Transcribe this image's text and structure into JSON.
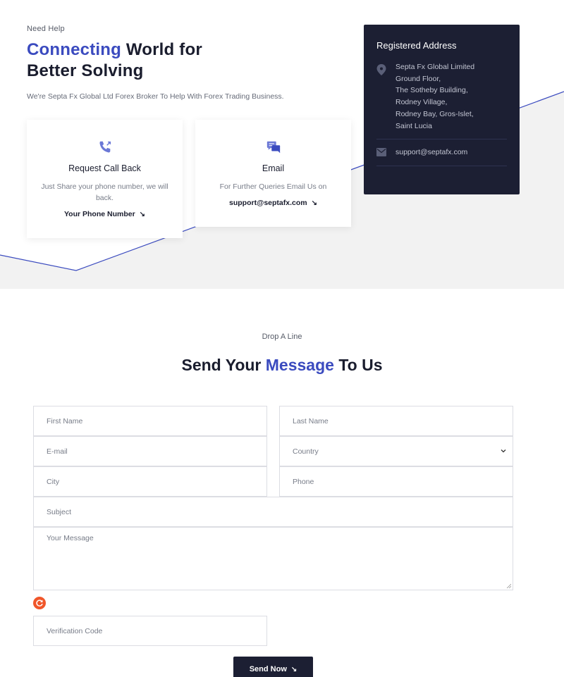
{
  "hero": {
    "eyebrow": "Need Help",
    "title_accent": "Connecting",
    "title_rest_line1": " World for",
    "title_line2": "Better Solving",
    "description": "We're Septa Fx Global Ltd Forex Broker To Help With Forex Trading Business."
  },
  "cards": {
    "callback": {
      "icon": "phone-icon",
      "title": "Request Call Back",
      "description": "Just Share your phone number, we will back.",
      "link": "Your Phone Number"
    },
    "email": {
      "icon": "chat-icon",
      "title": "Email",
      "description": "For Further Queries Email Us on",
      "link": "support@septafx.com"
    }
  },
  "address": {
    "title": "Registered Address",
    "lines": [
      "Septa Fx Global Limited",
      "Ground Floor,",
      "The Sotheby Building,",
      "Rodney Village,",
      "Rodney Bay, Gros-Islet,",
      "Saint Lucia"
    ],
    "email": "support@septafx.com"
  },
  "contact_form": {
    "eyebrow": "Drop A Line",
    "title_part1": "Send Your ",
    "title_accent": "Message",
    "title_part2": " To Us",
    "fields": {
      "first_name": "First Name",
      "last_name": "Last Name",
      "email": "E-mail",
      "country": "Country",
      "city": "City",
      "phone": "Phone",
      "subject": "Subject",
      "message": "Your Message",
      "verification": "Verification Code"
    },
    "submit_label": "Send Now"
  },
  "colors": {
    "accent": "#3b4bbf",
    "dark": "#1c1f33",
    "refresh": "#f0562a",
    "band_grey": "#f2f2f2"
  }
}
